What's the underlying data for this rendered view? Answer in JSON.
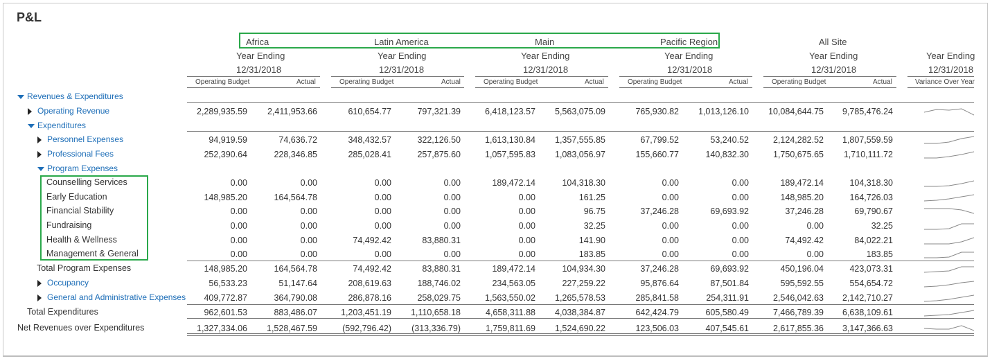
{
  "title": "P&L",
  "regions": [
    "Africa",
    "Latin America",
    "Main",
    "Pacific Region",
    "All Site"
  ],
  "year_ending_label": "Year Ending",
  "date": "12/31/2018",
  "col_sub": {
    "budget": "Operating Budget",
    "actual": "Actual",
    "variance": "Variance Over Year"
  },
  "colors": {
    "link": "#1f6fb8",
    "highlight": "#2aa84a",
    "text": "#333333"
  },
  "rows": [
    {
      "label": "Revenues & Expenditures",
      "kind": "group",
      "icon": "caret-down-icon",
      "values": null,
      "spark": null
    },
    {
      "label": "Operating Revenue",
      "kind": "link",
      "icon": "caret-right-icon",
      "values": [
        "2,289,935.59",
        "2,411,953.66",
        "610,654.77",
        "797,321.39",
        "6,418,123.57",
        "5,563,075.09",
        "765,930.82",
        "1,013,126.10",
        "10,084,644.75",
        "9,785,476.24"
      ],
      "spark": [
        8,
        4,
        5,
        3,
        12
      ]
    },
    {
      "label": "Expenditures",
      "kind": "group",
      "icon": "caret-down-icon",
      "values": null,
      "spark": null
    },
    {
      "label": "Personnel Expenses",
      "kind": "link",
      "icon": "caret-right-icon",
      "values": [
        "94,919.59",
        "74,636.72",
        "348,432.57",
        "322,126.50",
        "1,613,130.84",
        "1,357,555.85",
        "67,799.52",
        "53,240.52",
        "2,124,282.52",
        "1,807,559.59"
      ],
      "spark": [
        12,
        12,
        10,
        5,
        2
      ]
    },
    {
      "label": "Professional Fees",
      "kind": "link",
      "icon": "caret-right-icon",
      "values": [
        "252,390.64",
        "228,346.85",
        "285,028.41",
        "257,875.60",
        "1,057,595.83",
        "1,083,056.97",
        "155,660.77",
        "140,832.30",
        "1,750,675.65",
        "1,710,111.72"
      ],
      "spark": [
        12,
        12,
        10,
        7,
        3
      ]
    },
    {
      "label": "Program Expenses",
      "kind": "group",
      "icon": "caret-down-icon",
      "values": null,
      "spark": null
    },
    {
      "label": "Counselling Services",
      "kind": "item",
      "values": [
        "0.00",
        "0.00",
        "0.00",
        "0.00",
        "189,472.14",
        "104,318.30",
        "0.00",
        "0.00",
        "189,472.14",
        "104,318.30"
      ],
      "spark": [
        12,
        12,
        11,
        8,
        4
      ]
    },
    {
      "label": "Early Education",
      "kind": "item",
      "values": [
        "148,985.20",
        "164,564.78",
        "0.00",
        "0.00",
        "0.00",
        "161.25",
        "0.00",
        "0.00",
        "148,985.20",
        "164,726.03"
      ],
      "spark": [
        12,
        11,
        9,
        6,
        3
      ]
    },
    {
      "label": "Financial Stability",
      "kind": "item",
      "values": [
        "0.00",
        "0.00",
        "0.00",
        "0.00",
        "0.00",
        "96.75",
        "37,246.28",
        "69,693.92",
        "37,246.28",
        "69,790.67"
      ],
      "spark": [
        3,
        3,
        3,
        5,
        10
      ]
    },
    {
      "label": "Fundraising",
      "kind": "item",
      "values": [
        "0.00",
        "0.00",
        "0.00",
        "0.00",
        "0.00",
        "32.25",
        "0.00",
        "0.00",
        "0.00",
        "32.25"
      ],
      "spark": [
        12,
        12,
        11,
        4,
        4
      ]
    },
    {
      "label": "Health & Wellness",
      "kind": "item",
      "values": [
        "0.00",
        "0.00",
        "74,492.42",
        "83,880.31",
        "0.00",
        "141.90",
        "0.00",
        "0.00",
        "74,492.42",
        "84,022.21"
      ],
      "spark": [
        12,
        12,
        12,
        9,
        3
      ]
    },
    {
      "label": "Management & General",
      "kind": "item",
      "values": [
        "0.00",
        "0.00",
        "0.00",
        "0.00",
        "0.00",
        "183.85",
        "0.00",
        "0.00",
        "0.00",
        "183.85"
      ],
      "spark": [
        12,
        12,
        11,
        4,
        4
      ]
    },
    {
      "label": "Total Program Expenses",
      "kind": "total",
      "values": [
        "148,985.20",
        "164,564.78",
        "74,492.42",
        "83,880.31",
        "189,472.14",
        "104,934.30",
        "37,246.28",
        "69,693.92",
        "450,196.04",
        "423,073.31"
      ],
      "spark": [
        12,
        11,
        10,
        4,
        4
      ]
    },
    {
      "label": "Occupancy",
      "kind": "link",
      "icon": "caret-right-icon",
      "values": [
        "56,533.23",
        "51,147.64",
        "208,619.63",
        "188,746.02",
        "234,563.05",
        "227,259.22",
        "95,876.64",
        "87,501.84",
        "595,592.55",
        "554,654.72"
      ],
      "spark": [
        12,
        11,
        9,
        6,
        4
      ]
    },
    {
      "label": "General and Administrative Expenses",
      "kind": "link",
      "icon": "caret-right-icon",
      "values": [
        "409,772.87",
        "364,790.08",
        "286,878.16",
        "258,029.75",
        "1,563,550.02",
        "1,265,578.53",
        "285,841.58",
        "254,311.91",
        "2,546,042.63",
        "2,142,710.27"
      ],
      "spark": [
        12,
        11,
        9,
        6,
        3
      ]
    },
    {
      "label": "Total Expenditures",
      "kind": "total",
      "values": [
        "962,601.53",
        "883,486.07",
        "1,203,451.19",
        "1,110,658.18",
        "4,658,311.88",
        "4,038,384.87",
        "642,424.79",
        "605,580.49",
        "7,466,789.39",
        "6,638,109.61"
      ],
      "spark": [
        12,
        11,
        10,
        7,
        4
      ]
    },
    {
      "label": "Net Revenues over Expenditures",
      "kind": "grand",
      "values": [
        "1,327,334.06",
        "1,528,467.59",
        "(592,796.42)",
        "(313,336.79)",
        "1,759,811.69",
        "1,524,690.22",
        "123,506.03",
        "407,545.61",
        "2,617,855.36",
        "3,147,366.63"
      ],
      "spark": [
        7,
        8,
        8,
        3,
        10
      ]
    }
  ]
}
